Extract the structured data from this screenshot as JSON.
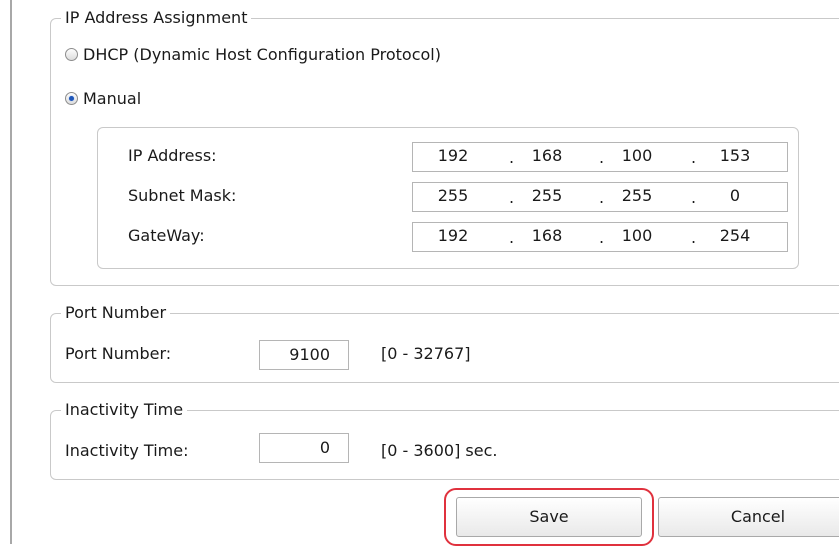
{
  "ip_assignment": {
    "legend": "IP Address Assignment",
    "dhcp_label": "DHCP (Dynamic Host Configuration Protocol)",
    "manual_label": "Manual",
    "selected": "manual",
    "fields": [
      {
        "label": "IP Address:",
        "octets": [
          "192",
          "168",
          "100",
          "153"
        ]
      },
      {
        "label": "Subnet Mask:",
        "octets": [
          "255",
          "255",
          "255",
          "0"
        ]
      },
      {
        "label": "GateWay:",
        "octets": [
          "192",
          "168",
          "100",
          "254"
        ]
      }
    ],
    "separator": "."
  },
  "port": {
    "legend": "Port Number",
    "label": "Port Number:",
    "value": "9100",
    "range": "[0 - 32767]"
  },
  "inactivity": {
    "legend": "Inactivity Time",
    "label": "Inactivity Time:",
    "value": "0",
    "range": "[0 - 3600] sec."
  },
  "buttons": {
    "save": "Save",
    "cancel": "Cancel"
  },
  "colors": {
    "highlight": "#e0313d",
    "radio_dot": "#1e56b8"
  }
}
